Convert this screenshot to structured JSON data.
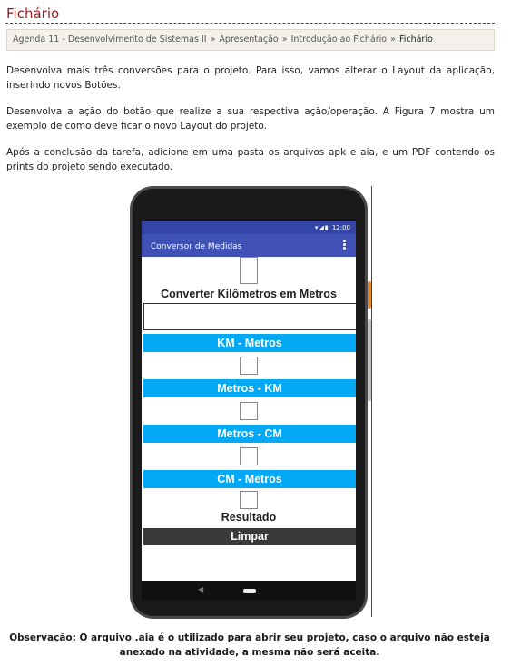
{
  "page": {
    "title": "Fichário"
  },
  "breadcrumb": {
    "items": [
      "Agenda 11 - Desenvolvimento de Sistemas II",
      "Apresentação",
      "Introdução ao Fichário"
    ],
    "current": "Fichário",
    "separator": "»"
  },
  "paragraphs": {
    "p1": "Desenvolva mais três conversões para o projeto. Para isso, vamos alterar o Layout da aplicação, inserindo novos Botões.",
    "p2": "Desenvolva a ação do botão que realize a sua respectiva ação/operação. A Figura 7 mostra um exemplo de como deve ficar o novo Layout do projeto.",
    "p3": "Após a conclusão da tarefa, adicione em uma pasta os arquivos apk e aia, e um PDF contendo os prints do projeto sendo executado."
  },
  "phone": {
    "status_time": "12:00",
    "app_title": "Conversor de Medidas",
    "heading": "Converter Kilômetros em Metros",
    "buttons": [
      "KM - Metros",
      "Metros - KM",
      "Metros - CM",
      "CM - Metros"
    ],
    "result_label": "Resultado",
    "clear_label": "Limpar",
    "colors": {
      "status_bar": "#3346a8",
      "app_bar": "#3f51b5",
      "button": "#03a9f4",
      "clear_button": "#3a3a3a"
    }
  },
  "observation": {
    "line1": "Observação: O arquivo .aia é o utilizado para abrir seu projeto, caso o arquivo não esteja",
    "line2": "anexado na atividade, a mesma não será aceita."
  }
}
